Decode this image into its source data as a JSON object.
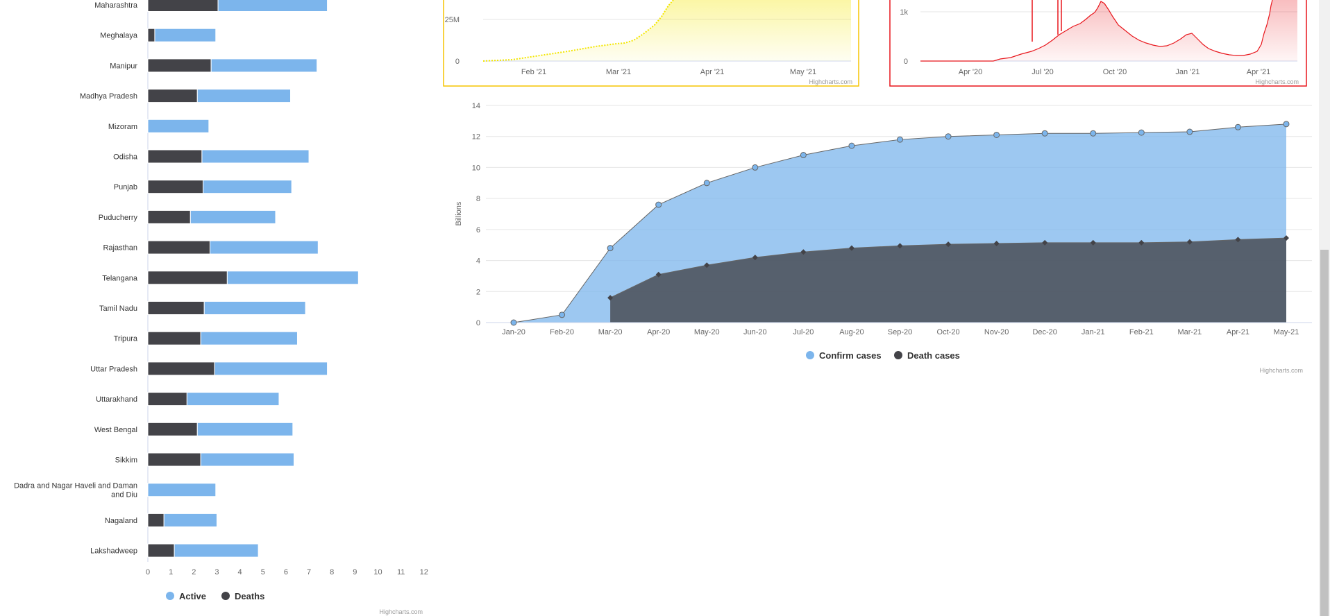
{
  "credits": "Highcharts.com",
  "colors": {
    "active": "#7cb5ec",
    "deaths": "#434348",
    "yellow": "#f3e600",
    "red": "#e8151b",
    "yellow_border": "#f5c400",
    "red_border": "#e8151b"
  },
  "chart_data": [
    {
      "type": "bar",
      "stacked": true,
      "orientation": "horizontal",
      "categories": [
        "Maharashtra",
        "Meghalaya",
        "Manipur",
        "Madhya Pradesh",
        "Mizoram",
        "Odisha",
        "Punjab",
        "Puducherry",
        "Rajasthan",
        "Telangana",
        "Tamil Nadu",
        "Tripura",
        "Uttar Pradesh",
        "Uttarakhand",
        "West Bengal",
        "Sikkim",
        "Dadra and Nagar Haveli and Daman and Diu",
        "Nagaland",
        "Lakshadweep"
      ],
      "series": [
        {
          "name": "Deaths",
          "color": "#434348",
          "values": [
            3.05,
            0.3,
            2.75,
            2.15,
            0,
            2.35,
            2.4,
            1.85,
            2.7,
            3.45,
            2.45,
            2.3,
            2.9,
            1.7,
            2.15,
            2.3,
            0,
            0.7,
            1.15
          ]
        },
        {
          "name": "Active",
          "color": "#7cb5ec",
          "values": [
            4.75,
            2.65,
            4.6,
            4.05,
            2.65,
            4.65,
            3.85,
            3.7,
            4.7,
            5.7,
            4.4,
            4.2,
            4.9,
            4.0,
            4.15,
            4.05,
            2.95,
            2.3,
            3.65
          ]
        }
      ],
      "xticks": [
        "0",
        "1",
        "2",
        "3",
        "4",
        "5",
        "6",
        "7",
        "8",
        "9",
        "10",
        "11",
        "12"
      ],
      "xlim": [
        0,
        12
      ],
      "legend": [
        "Active",
        "Deaths"
      ],
      "legend_position": "bottom"
    },
    {
      "type": "area",
      "color": "#f3e600",
      "yticks": [
        "0",
        "25M"
      ],
      "xticks": [
        "Feb '21",
        "Mar '21",
        "Apr '21",
        "May '21"
      ],
      "note": "cumulative values rising steeply from March 2021; top clipped in view"
    },
    {
      "type": "area",
      "color": "#e8151b",
      "yticks": [
        "0",
        "1k"
      ],
      "xticks": [
        "Apr '20",
        "Jul '20",
        "Oct '20",
        "Jan '21",
        "Apr '21"
      ]
    },
    {
      "type": "area",
      "categories": [
        "Jan-20",
        "Feb-20",
        "Mar-20",
        "Apr-20",
        "May-20",
        "Jun-20",
        "Jul-20",
        "Aug-20",
        "Sep-20",
        "Oct-20",
        "Nov-20",
        "Dec-20",
        "Jan-21",
        "Feb-21",
        "Mar-21",
        "Apr-21",
        "May-21"
      ],
      "series": [
        {
          "name": "Confirm cases",
          "color": "#7cb5ec",
          "values": [
            0,
            0.5,
            4.8,
            7.6,
            9.0,
            10.0,
            10.8,
            11.4,
            11.8,
            12.0,
            12.1,
            12.2,
            12.2,
            12.25,
            12.3,
            12.6,
            12.8
          ]
        },
        {
          "name": "Death cases",
          "color": "#434348",
          "values": [
            null,
            null,
            1.6,
            3.1,
            3.7,
            4.2,
            4.55,
            4.8,
            4.95,
            5.05,
            5.1,
            5.15,
            5.15,
            5.15,
            5.2,
            5.35,
            5.45
          ]
        }
      ],
      "ylabel": "Billions",
      "ylim": [
        0,
        14
      ],
      "yticks": [
        "0",
        "2",
        "4",
        "6",
        "8",
        "10",
        "12",
        "14"
      ],
      "legend": [
        "Confirm cases",
        "Death cases"
      ],
      "legend_position": "bottom"
    }
  ]
}
